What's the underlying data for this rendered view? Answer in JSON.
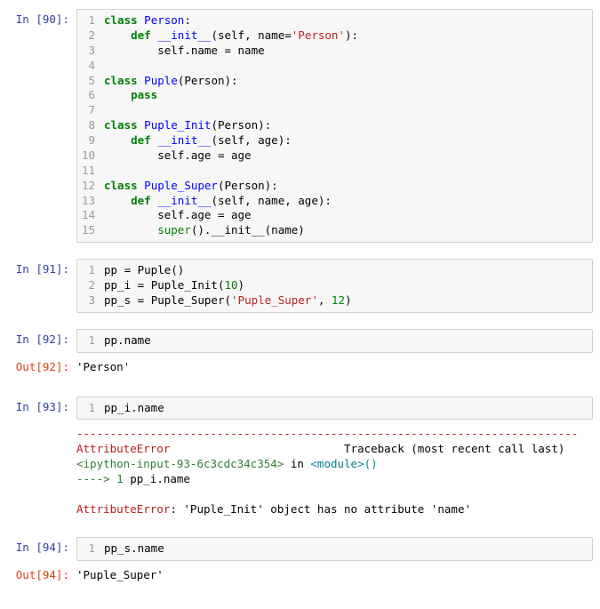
{
  "cells": [
    {
      "type": "code",
      "prompt_in": "In [90]:",
      "lines": [
        {
          "n": "1",
          "tokens": [
            [
              "kw",
              "class"
            ],
            [
              "p",
              " "
            ],
            [
              "cls",
              "Person"
            ],
            [
              "p",
              ":"
            ]
          ]
        },
        {
          "n": "2",
          "tokens": [
            [
              "p",
              "    "
            ],
            [
              "def",
              "def"
            ],
            [
              "p",
              " "
            ],
            [
              "magic",
              "__init__"
            ],
            [
              "p",
              "(self, name"
            ],
            [
              "p",
              "="
            ],
            [
              "str",
              "'Person'"
            ],
            [
              "p",
              "):"
            ]
          ]
        },
        {
          "n": "3",
          "tokens": [
            [
              "p",
              "        self.name "
            ],
            [
              "p",
              "="
            ],
            [
              "p",
              " name"
            ]
          ]
        },
        {
          "n": "4",
          "tokens": [
            [
              "p",
              ""
            ]
          ]
        },
        {
          "n": "5",
          "tokens": [
            [
              "kw",
              "class"
            ],
            [
              "p",
              " "
            ],
            [
              "cls",
              "Puple"
            ],
            [
              "p",
              "(Person):"
            ]
          ]
        },
        {
          "n": "6",
          "tokens": [
            [
              "p",
              "    "
            ],
            [
              "kw",
              "pass"
            ]
          ]
        },
        {
          "n": "7",
          "tokens": [
            [
              "p",
              ""
            ]
          ]
        },
        {
          "n": "8",
          "tokens": [
            [
              "kw",
              "class"
            ],
            [
              "p",
              " "
            ],
            [
              "cls",
              "Puple_Init"
            ],
            [
              "p",
              "(Person):"
            ]
          ]
        },
        {
          "n": "9",
          "tokens": [
            [
              "p",
              "    "
            ],
            [
              "def",
              "def"
            ],
            [
              "p",
              " "
            ],
            [
              "magic",
              "__init__"
            ],
            [
              "p",
              "(self, age):"
            ]
          ]
        },
        {
          "n": "10",
          "tokens": [
            [
              "p",
              "        self.age "
            ],
            [
              "p",
              "="
            ],
            [
              "p",
              " age"
            ]
          ]
        },
        {
          "n": "11",
          "tokens": [
            [
              "p",
              ""
            ]
          ]
        },
        {
          "n": "12",
          "tokens": [
            [
              "kw",
              "class"
            ],
            [
              "p",
              " "
            ],
            [
              "cls",
              "Puple_Super"
            ],
            [
              "p",
              "(Person):"
            ]
          ]
        },
        {
          "n": "13",
          "tokens": [
            [
              "p",
              "    "
            ],
            [
              "def",
              "def"
            ],
            [
              "p",
              " "
            ],
            [
              "magic",
              "__init__"
            ],
            [
              "p",
              "(self, name, age):"
            ]
          ]
        },
        {
          "n": "14",
          "tokens": [
            [
              "p",
              "        self.age "
            ],
            [
              "p",
              "="
            ],
            [
              "p",
              " age"
            ]
          ]
        },
        {
          "n": "15",
          "tokens": [
            [
              "p",
              "        "
            ],
            [
              "bi",
              "super"
            ],
            [
              "p",
              "()."
            ],
            [
              "p",
              "__init__(name)"
            ]
          ]
        }
      ]
    },
    {
      "type": "code",
      "prompt_in": "In [91]:",
      "lines": [
        {
          "n": "1",
          "tokens": [
            [
              "p",
              "pp "
            ],
            [
              "p",
              "="
            ],
            [
              "p",
              " Puple()"
            ]
          ]
        },
        {
          "n": "2",
          "tokens": [
            [
              "p",
              "pp_i "
            ],
            [
              "p",
              "="
            ],
            [
              "p",
              " Puple_Init("
            ],
            [
              "num",
              "10"
            ],
            [
              "p",
              ")"
            ]
          ]
        },
        {
          "n": "3",
          "tokens": [
            [
              "p",
              "pp_s "
            ],
            [
              "p",
              "="
            ],
            [
              "p",
              " Puple_Super("
            ],
            [
              "str",
              "'Puple_Super'"
            ],
            [
              "p",
              ", "
            ],
            [
              "num",
              "12"
            ],
            [
              "p",
              ")"
            ]
          ]
        }
      ]
    },
    {
      "type": "code",
      "prompt_in": "In [92]:",
      "lines": [
        {
          "n": "1",
          "tokens": [
            [
              "p",
              "pp.name"
            ]
          ]
        }
      ],
      "prompt_out": "Out[92]:",
      "output_text": "'Person'"
    },
    {
      "type": "code",
      "prompt_in": "In [93]:",
      "lines": [
        {
          "n": "1",
          "tokens": [
            [
              "p",
              "pp_i.name"
            ]
          ]
        }
      ],
      "error": {
        "dash": "---------------------------------------------------------------------------",
        "header_name": "AttributeError",
        "header_tb": "                          Traceback (most recent call last)",
        "loc": "<ipython-input-93-6c3cdc34c354>",
        "in_kw": " in ",
        "module": "<module>()",
        "arrow": "----> 1 ",
        "arrow_code": "pp_i.name",
        "final_name": "AttributeError",
        "final_msg": ": 'Puple_Init' object has no attribute 'name'"
      }
    },
    {
      "type": "code",
      "prompt_in": "In [94]:",
      "lines": [
        {
          "n": "1",
          "tokens": [
            [
              "p",
              "pp_s.name"
            ]
          ]
        }
      ],
      "prompt_out": "Out[94]:",
      "output_text": "'Puple_Super'"
    }
  ]
}
